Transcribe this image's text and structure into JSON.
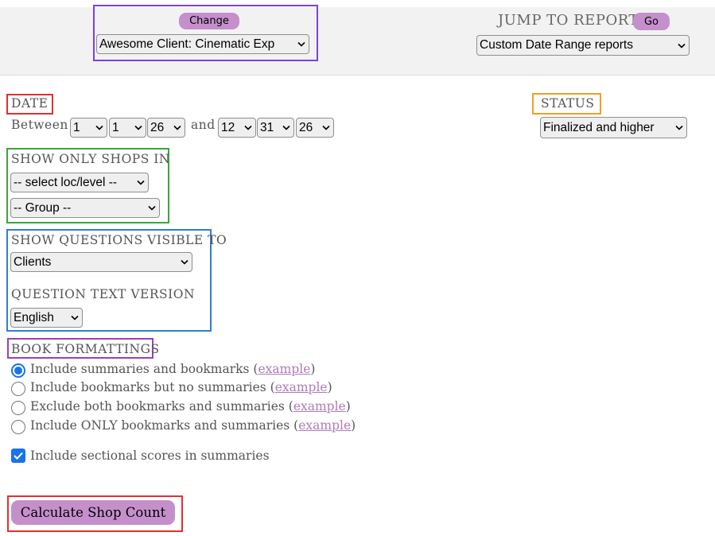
{
  "header": {
    "change_label": "Change",
    "client_select": "Awesome Client: Cinematic Exp",
    "jump_label": "JUMP TO REPORT",
    "go_label": "Go",
    "report_select": "Custom Date Range reports"
  },
  "date": {
    "label": "DATE",
    "between": "Between",
    "and": "and",
    "start_month": "1",
    "start_day": "1",
    "start_year": "26",
    "end_month": "12",
    "end_day": "31",
    "end_year": "26"
  },
  "status": {
    "label": "STATUS",
    "value": "Finalized and higher"
  },
  "shops": {
    "label": "SHOW ONLY SHOPS IN",
    "loc_level": "-- select loc/level --",
    "group": "-- Group --"
  },
  "questions": {
    "label": "SHOW QUESTIONS VISIBLE TO",
    "visible_to": "Clients",
    "text_version_label": "QUESTION TEXT VERSION",
    "text_version": "English"
  },
  "book": {
    "label": "BOOK FORMATTINGS",
    "example": "example",
    "options": [
      {
        "text": "Include summaries and bookmarks",
        "selected": true
      },
      {
        "text": "Include bookmarks but no summaries",
        "selected": false
      },
      {
        "text": "Exclude both bookmarks and summaries",
        "selected": false
      },
      {
        "text": "Include ONLY bookmarks and summaries",
        "selected": false
      }
    ],
    "sectional_label": "Include sectional scores in summaries",
    "sectional_checked": true
  },
  "calculate_label": "Calculate Shop Count",
  "colors": {
    "accent": "#c58fcc",
    "radio_blue": "#1a73e8",
    "link": "#b07ab8",
    "header_bg": "#f2f2f2",
    "box_purple": "#7b3fe4",
    "box_red": "#e03030",
    "box_orange": "#f0a020",
    "box_green": "#3aa63a",
    "box_blue": "#2f7fd0",
    "box_violet": "#9b40b8"
  }
}
